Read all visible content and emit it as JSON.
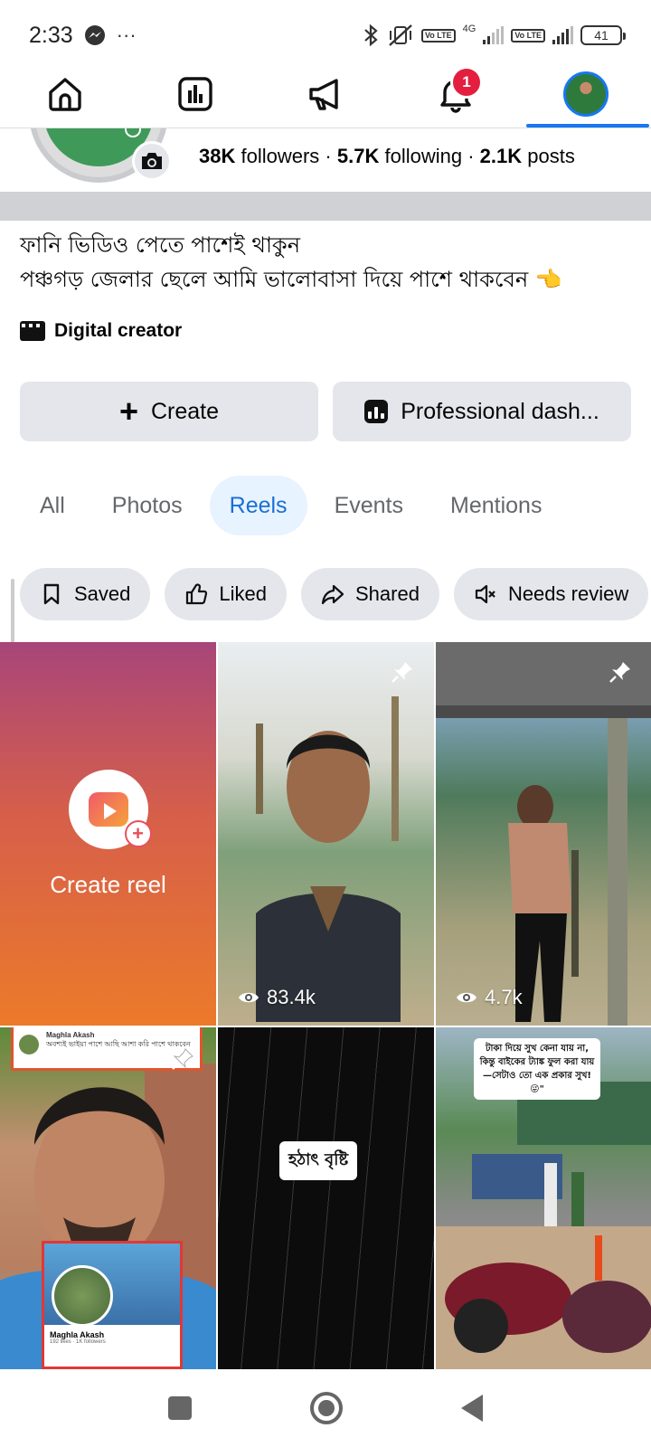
{
  "status_bar": {
    "time": "2:33",
    "more": "···",
    "network": "4G",
    "volte_1": "Vo LTE",
    "volte_2": "Vo LTE",
    "battery": "41"
  },
  "top_nav": {
    "items": [
      "home-icon",
      "dashboard-icon",
      "megaphone-icon",
      "bell-icon",
      "profile-avatar"
    ],
    "notification_count": "1",
    "active": "profile"
  },
  "profile": {
    "followers_count": "38K",
    "followers_label": "followers",
    "following_count": "5.7K",
    "following_label": "following",
    "posts_count": "2.1K",
    "posts_label": "posts",
    "separator": "·"
  },
  "bio": {
    "line1": "ফানি ভিডিও পেতে পাশেই থাকুন",
    "line2": "পঞ্চগড় জেলার ছেলে আমি ভালোবাসা দিয়ে পাশে থাকবেন 👈"
  },
  "category": {
    "label": "Digital creator"
  },
  "actions": {
    "create_label": "Create",
    "professional_label": "Professional dash..."
  },
  "tabs": {
    "items": [
      "All",
      "Photos",
      "Reels",
      "Events",
      "Mentions"
    ],
    "active": "Reels"
  },
  "chips": {
    "saved": "Saved",
    "liked": "Liked",
    "shared": "Shared",
    "needs_review": "Needs review"
  },
  "reels": {
    "create_label": "Create reel",
    "items": [
      {
        "views": "83.4k",
        "pinned": true
      },
      {
        "views": "4.7k",
        "pinned": true
      },
      {
        "pinned": true,
        "comment_name": "Maghla Akash",
        "comment_text": "অবশ্যই ভাইয়া পাশে আছি আশা করি পাশে থাকবেন",
        "card_name": "Maghla Akash",
        "card_sub": "192 likes · 1K followers"
      },
      {
        "caption": "হঠাৎ বৃষ্টি"
      },
      {
        "caption": "টাকা দিয়ে সুখ কেনা যায় না, কিন্তু বাইকের ট্যাঙ্ক ফুল করা যায়—সেটাও তো এক প্রকার সুখ! 😜\""
      }
    ]
  },
  "colors": {
    "accent": "#1877f2",
    "badge": "#e41e3f",
    "tab_active_bg": "#e7f3ff",
    "chip_bg": "#e4e6eb"
  }
}
